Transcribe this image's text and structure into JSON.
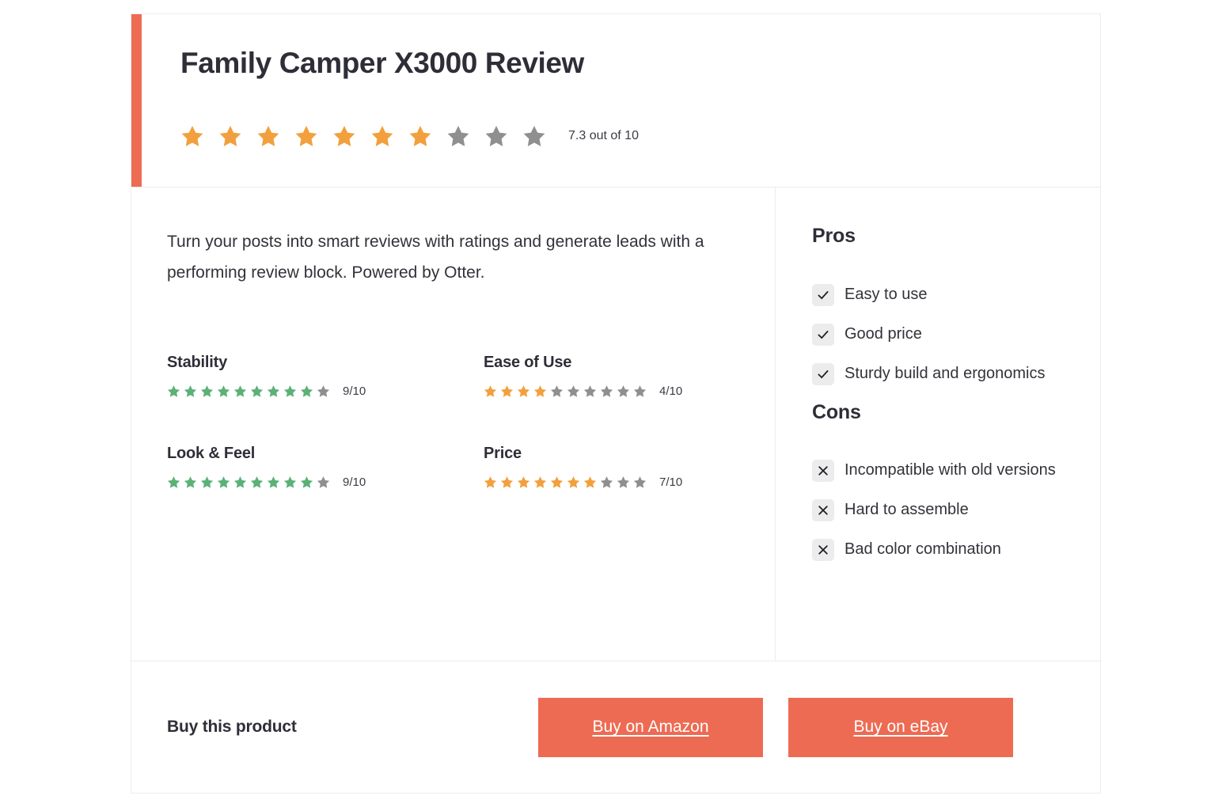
{
  "review": {
    "title": "Family Camper X3000 Review",
    "overall": {
      "score_text": "7.3 out of 10",
      "value": 7.3,
      "max": 10,
      "filled_stars": 7,
      "total_stars": 10,
      "star_color": "#f2a03d",
      "empty_star_color": "#8f8f8f"
    },
    "description": "Turn your posts into smart reviews with ratings and generate leads with a performing review block. Powered by Otter.",
    "criteria": [
      {
        "label": "Stability",
        "score_text": "9/10",
        "value": 9,
        "max": 10,
        "filled_stars": 9,
        "total_stars": 10,
        "star_color": "#5cb176"
      },
      {
        "label": "Ease of Use",
        "score_text": "4/10",
        "value": 4,
        "max": 10,
        "filled_stars": 4,
        "total_stars": 10,
        "star_color": "#f2a03d"
      },
      {
        "label": "Look & Feel",
        "score_text": "9/10",
        "value": 9,
        "max": 10,
        "filled_stars": 9,
        "total_stars": 10,
        "star_color": "#5cb176"
      },
      {
        "label": "Price",
        "score_text": "7/10",
        "value": 7,
        "max": 10,
        "filled_stars": 7,
        "total_stars": 10,
        "star_color": "#f2a03d"
      }
    ],
    "pros": {
      "heading": "Pros",
      "icon": "check-icon",
      "items": [
        "Easy to use",
        "Good price",
        "Sturdy build and ergonomics"
      ]
    },
    "cons": {
      "heading": "Cons",
      "icon": "cross-icon",
      "items": [
        "Incompatible with old versions",
        "Hard to assemble",
        "Bad color combination"
      ]
    },
    "footer": {
      "buy_label": "Buy this product",
      "buttons": [
        {
          "label": "Buy on Amazon"
        },
        {
          "label": "Buy on eBay"
        }
      ]
    },
    "colors": {
      "accent": "#ed6b53",
      "star_orange": "#f2a03d",
      "star_green": "#5cb176",
      "star_empty": "#8f8f8f",
      "text_dark": "#2e2e38",
      "border": "#ececec"
    }
  }
}
